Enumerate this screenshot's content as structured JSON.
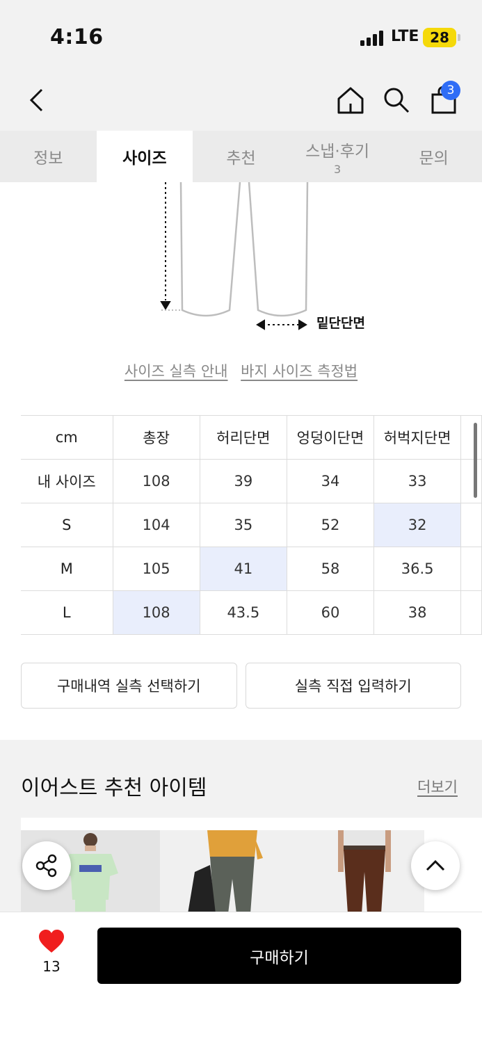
{
  "status": {
    "time": "4:16",
    "network": "LTE",
    "battery": "28"
  },
  "header": {
    "cart_count": "3"
  },
  "tabs": [
    {
      "label": "정보",
      "count": ""
    },
    {
      "label": "사이즈",
      "count": ""
    },
    {
      "label": "추천",
      "count": ""
    },
    {
      "label": "스냅·후기",
      "count": "3"
    },
    {
      "label": "문의",
      "count": ""
    }
  ],
  "diagram": {
    "measure_label": "밑단단면"
  },
  "links": {
    "size_guide": "사이즈 실측 안내",
    "measure_guide": "바지 사이즈 측정법"
  },
  "size_table": {
    "unit": "cm",
    "headers": [
      "총장",
      "허리단면",
      "엉덩이단면",
      "허벅지단면"
    ],
    "rows": [
      {
        "label": "내 사이즈",
        "values": [
          "108",
          "39",
          "34",
          "33"
        ]
      },
      {
        "label": "S",
        "values": [
          "104",
          "35",
          "52",
          "32"
        ]
      },
      {
        "label": "M",
        "values": [
          "105",
          "41",
          "58",
          "36.5"
        ]
      },
      {
        "label": "L",
        "values": [
          "108",
          "43.5",
          "60",
          "38"
        ]
      }
    ]
  },
  "actions": {
    "purchase_history": "구매내역 실측 선택하기",
    "manual_input": "실측 직접 입력하기"
  },
  "recommend": {
    "title": "이어스트 추천 아이템",
    "more": "더보기"
  },
  "bottom": {
    "like_count": "13",
    "buy_label": "구매하기"
  },
  "colors": {
    "highlight": "#e9eefc",
    "badge": "#2f6df6",
    "heart": "#f01e1e",
    "battery": "#f5d90a"
  }
}
